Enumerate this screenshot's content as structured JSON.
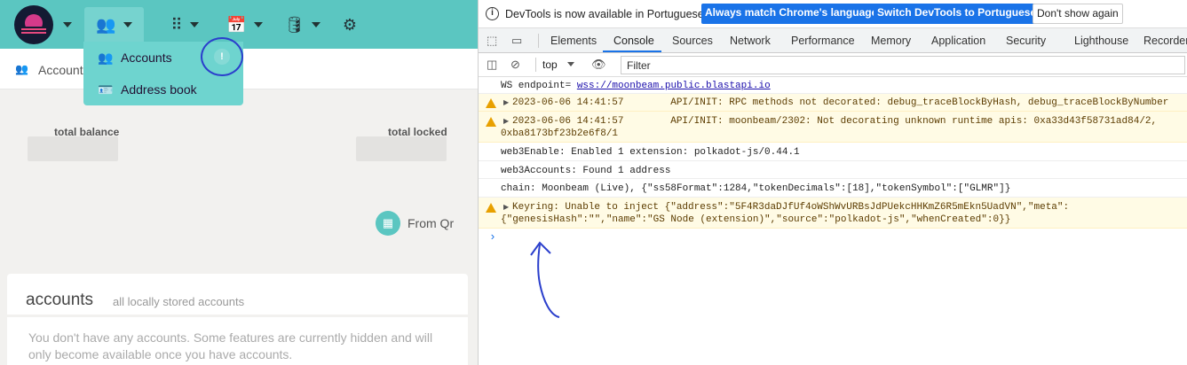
{
  "app": {
    "nav": {
      "accounts_icon": "users-icon",
      "apps_icon": "grid-icon",
      "calendar_icon": "calendar-icon",
      "db_icon": "database-icon",
      "settings_icon": "gears-icon"
    },
    "dropdown": {
      "items": [
        {
          "label": "Accounts",
          "icon": "users-icon"
        },
        {
          "label": "Address book",
          "icon": "address-card-icon"
        }
      ],
      "badge": "!"
    },
    "subbar": {
      "label": "Account"
    },
    "stats": {
      "total_balance": "total balance",
      "total_locked": "total locked"
    },
    "from_qr": "From Qr",
    "accounts_card": {
      "title": "accounts",
      "subtitle": "all locally stored accounts",
      "empty_message": "You don't have any accounts. Some features are currently hidden and will only become available once you have accounts."
    }
  },
  "devtools": {
    "infobar": {
      "text": "DevTools is now available in Portuguese!",
      "btn_match": "Always match Chrome's language",
      "btn_switch": "Switch DevTools to Portuguese",
      "btn_dismiss": "Don't show again"
    },
    "tabs": [
      "Elements",
      "Console",
      "Sources",
      "Network",
      "Performance",
      "Memory",
      "Application",
      "Security",
      "Lighthouse",
      "Recorder"
    ],
    "active_tab": "Console",
    "context": "top",
    "filter_placeholder": "Filter",
    "console": {
      "line1_prefix": "WS endpoint= ",
      "line1_link": "wss://moonbeam.public.blastapi.io",
      "line2": "2023-06-06 14:41:57        API/INIT: RPC methods not decorated: debug_traceBlockByHash, debug_traceBlockByNumber",
      "line3a": "2023-06-06 14:41:57        API/INIT: moonbeam/2302: Not decorating unknown runtime apis: 0xa33d43f58731ad84/2,",
      "line3b": "0xba8173bf23b2e6f8/1",
      "line4": "web3Enable: Enabled 1 extension: polkadot-js/0.44.1",
      "line5": "web3Accounts: Found 1 address",
      "line6": "chain: Moonbeam (Live), {\"ss58Format\":1284,\"tokenDecimals\":[18],\"tokenSymbol\":[\"GLMR\"]}",
      "line7a": "Keyring: Unable to inject {\"address\":\"5F4R3daDJfUf4oWShWvURBsJdPUekcHHKmZ6R5mEkn5UadVN\",\"meta\":",
      "line7b": "{\"genesisHash\":\"\",\"name\":\"GS Node (extension)\",\"source\":\"polkadot-js\",\"whenCreated\":0}}",
      "prompt": "›"
    }
  }
}
